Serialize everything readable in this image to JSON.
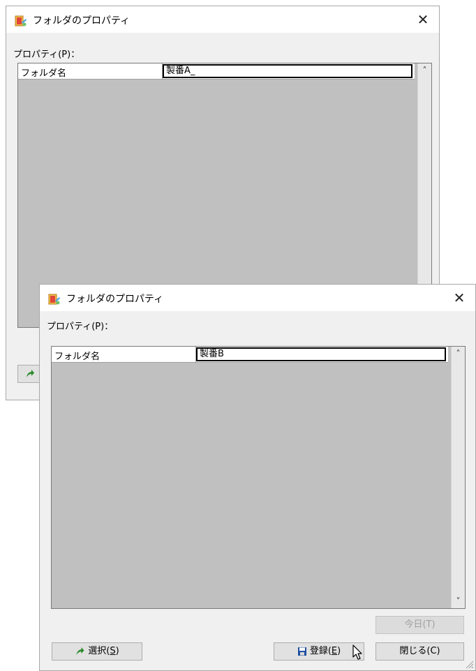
{
  "dialog_back": {
    "title": "フォルダのプロパティ",
    "close_glyph": "✕",
    "properties_label": "プロパティ(P)：",
    "row": {
      "name": "フォルダ名",
      "value": "製番A_"
    },
    "scroll_up": "˄"
  },
  "dialog_front": {
    "title": "フォルダのプロパティ",
    "close_glyph": "✕",
    "properties_label": "プロパティ(P)：",
    "row": {
      "name": "フォルダ名",
      "value": "製番B"
    },
    "scroll_up": "˄",
    "scroll_down": "˅",
    "buttons": {
      "today": "今日(T)",
      "select_text": "選択(",
      "select_key": "S",
      "select_tail": ")",
      "register_text": "登録(",
      "register_key": "E",
      "register_tail": ")",
      "close": "閉じる(C)"
    }
  },
  "icons": [
    "folder-properties-app-icon",
    "close-icon",
    "scroll-up-arrow-icon",
    "scroll-down-arrow-icon",
    "select-arrow-icon",
    "floppy-save-icon",
    "mouse-cursor-icon",
    "resize-grip-icon"
  ],
  "colors": {
    "grid_bg": "#c0c0c0",
    "dialog_bg": "#f0f0f0",
    "titlebar_bg": "#ffffff",
    "select_arrow": "#2a8a2a",
    "save_icon": "#1e4fa0"
  }
}
